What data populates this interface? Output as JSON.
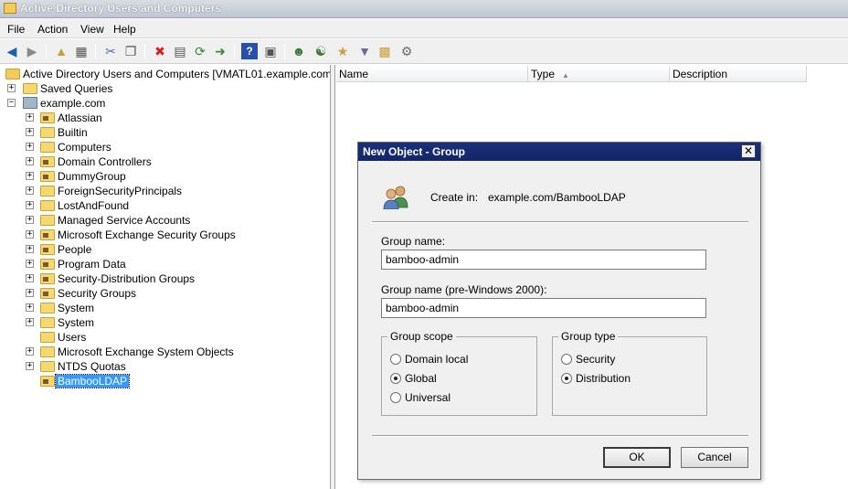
{
  "window": {
    "title": "Active Directory Users and Computers"
  },
  "menu": [
    "File",
    "Action",
    "View",
    "Help"
  ],
  "toolbar_icons": [
    "back-arrow-icon",
    "forward-arrow-icon",
    "up-folder-icon",
    "show-console-tree-icon",
    "cut-icon",
    "copy-icon",
    "delete-icon",
    "properties-icon",
    "refresh-icon",
    "export-list-icon",
    "help-icon",
    "action-pane-icon",
    "new-user-icon",
    "new-group-icon",
    "new-ou-icon",
    "filter-icon",
    "add-to-group-icon",
    "delegate-icon"
  ],
  "tree": {
    "root": "Active Directory Users and Computers [VMATL01.example.com]",
    "saved_queries": "Saved Queries",
    "domain": "example.com",
    "items": [
      "Atlassian",
      "Builtin",
      "Computers",
      "Domain Controllers",
      "DummyGroup",
      "ForeignSecurityPrincipals",
      "LostAndFound",
      "Managed Service Accounts",
      "Microsoft Exchange Security Groups",
      "People",
      "Program Data",
      "Security-Distribution Groups",
      "Security Groups",
      "System",
      "System",
      "Users",
      "Microsoft Exchange System Objects",
      "NTDS Quotas",
      "BambooLDAP"
    ],
    "selected": "BambooLDAP"
  },
  "list": {
    "columns": [
      "Name",
      "Type",
      "Description"
    ]
  },
  "dialog": {
    "title": "New Object - Group",
    "create_in_label": "Create in:",
    "create_in_value": "example.com/BambooLDAP",
    "group_name_label": "Group name:",
    "group_name_value": "bamboo-admin",
    "pre2000_label": "Group name (pre-Windows 2000):",
    "pre2000_value": "bamboo-admin",
    "scope": {
      "legend": "Group scope",
      "options": [
        "Domain local",
        "Global",
        "Universal"
      ],
      "selected": "Global"
    },
    "type": {
      "legend": "Group type",
      "options": [
        "Security",
        "Distribution"
      ],
      "selected": "Distribution"
    },
    "ok": "OK",
    "cancel": "Cancel"
  }
}
